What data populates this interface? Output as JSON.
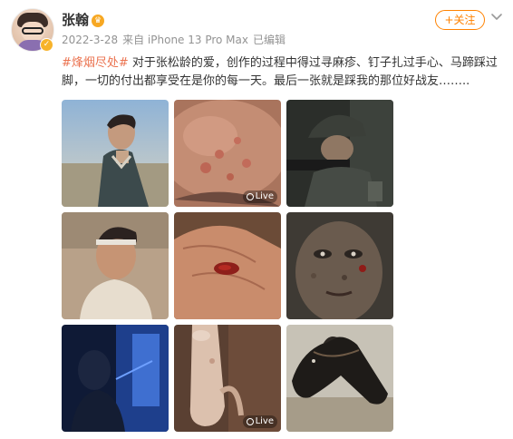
{
  "post": {
    "author": "张翰",
    "meta": {
      "date": "2022-3-28",
      "source": "来自 iPhone 13 Pro Max",
      "edited": "已编辑"
    },
    "follow_label": "+关注",
    "topic": "#烽烟尽处#",
    "text": " 对于张松龄的爱，创作的过程中得过寻麻疹、钉子扎过手心、马蹄踩过脚，一切的付出都享受在是你的每一天。最后一张就是踩我的那位好战友……..",
    "images": [
      {
        "subject": "man-in-jacket-outdoors",
        "live": false
      },
      {
        "subject": "skin-rash-closeup",
        "live": true
      },
      {
        "subject": "soldier-with-helmet-aiming",
        "live": false
      },
      {
        "subject": "man-with-headband",
        "live": false
      },
      {
        "subject": "wounded-palm",
        "live": false
      },
      {
        "subject": "mud-covered-face",
        "live": false
      },
      {
        "subject": "blue-lit-scene",
        "live": false
      },
      {
        "subject": "injured-foot",
        "live": true
      },
      {
        "subject": "black-horse",
        "live": false
      }
    ],
    "live_label": "Live"
  },
  "colors": {
    "accent": "#ff8200",
    "topic": "#eb7350",
    "meta": "#939393"
  }
}
